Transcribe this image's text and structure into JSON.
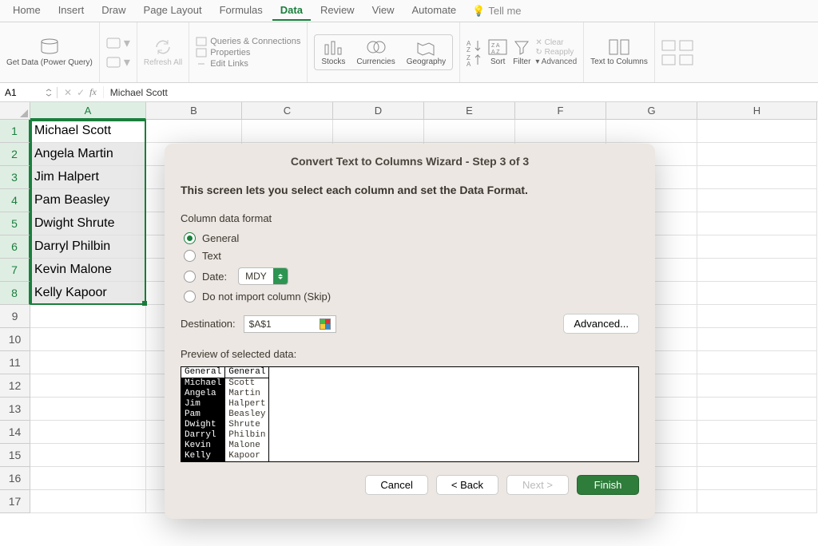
{
  "tabs": {
    "home": "Home",
    "insert": "Insert",
    "draw": "Draw",
    "pagelayout": "Page Layout",
    "formulas": "Formulas",
    "data": "Data",
    "review": "Review",
    "view": "View",
    "automate": "Automate",
    "tellme": "Tell me"
  },
  "ribbon": {
    "getdata": "Get Data (Power Query)",
    "refresh": "Refresh All",
    "queries": "Queries & Connections",
    "properties": "Properties",
    "editlinks": "Edit Links",
    "stocks": "Stocks",
    "currencies": "Currencies",
    "geography": "Geography",
    "sort": "Sort",
    "filter": "Filter",
    "clear": "Clear",
    "reapply": "Reapply",
    "advanced": "Advanced",
    "texttocols": "Text to Columns"
  },
  "namebox": "A1",
  "formula": "Michael Scott",
  "columns": [
    "A",
    "B",
    "C",
    "D",
    "E",
    "F",
    "G",
    "H"
  ],
  "rownums": [
    "1",
    "2",
    "3",
    "4",
    "5",
    "6",
    "7",
    "8",
    "9",
    "10",
    "11",
    "12",
    "13",
    "14",
    "15",
    "16",
    "17"
  ],
  "cellsA": [
    "Michael Scott",
    "Angela Martin",
    "Jim Halpert",
    "Pam Beasley",
    "Dwight Shrute",
    "Darryl Philbin",
    "Kevin Malone",
    "Kelly Kapoor"
  ],
  "dialog": {
    "title": "Convert Text to Columns Wizard - Step 3 of 3",
    "instruction": "This screen lets you select each column and set the Data Format.",
    "section": "Column data format",
    "opt_general": "General",
    "opt_text": "Text",
    "opt_date": "Date:",
    "date_fmt": "MDY",
    "opt_skip": "Do not import column (Skip)",
    "dest_label": "Destination:",
    "dest_value": "$A$1",
    "advanced": "Advanced...",
    "preview_label": "Preview of selected data:",
    "preview_header": [
      "General",
      "General"
    ],
    "preview_rows": [
      [
        "Michael",
        "Scott"
      ],
      [
        "Angela",
        "Martin"
      ],
      [
        "Jim",
        "Halpert"
      ],
      [
        "Pam",
        "Beasley"
      ],
      [
        "Dwight",
        "Shrute"
      ],
      [
        "Darryl",
        "Philbin"
      ],
      [
        "Kevin",
        "Malone"
      ],
      [
        "Kelly",
        "Kapoor"
      ]
    ],
    "btn_cancel": "Cancel",
    "btn_back": "< Back",
    "btn_next": "Next >",
    "btn_finish": "Finish"
  }
}
